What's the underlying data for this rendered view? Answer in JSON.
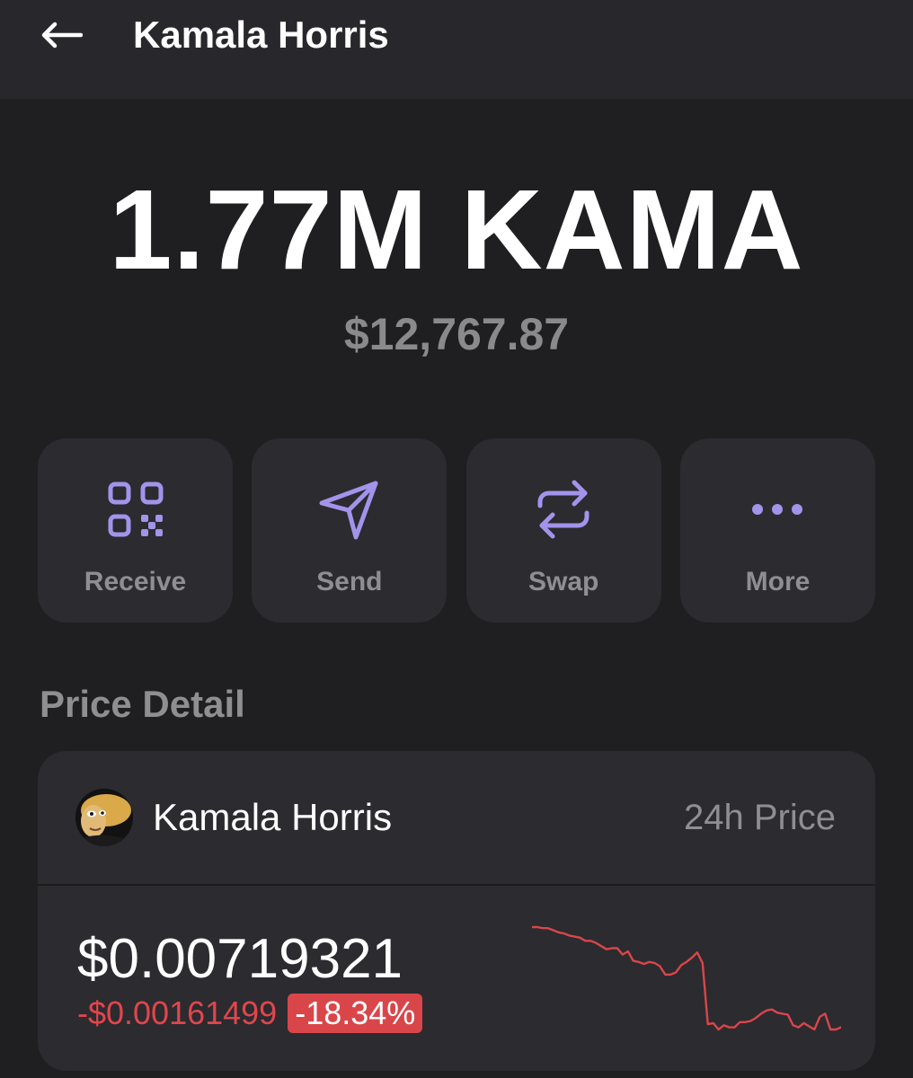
{
  "header": {
    "title": "Kamala Horris"
  },
  "balance": {
    "amount": "1.77M KAMA",
    "fiat_value": "$12,767.87"
  },
  "actions": [
    {
      "label": "Receive",
      "icon": "qr-code-icon"
    },
    {
      "label": "Send",
      "icon": "paper-plane-icon"
    },
    {
      "label": "Swap",
      "icon": "swap-arrows-icon"
    },
    {
      "label": "More",
      "icon": "more-dots-icon"
    }
  ],
  "price_detail": {
    "section_title": "Price Detail",
    "token_name": "Kamala Horris",
    "period_label": "24h Price",
    "price": "$0.00719321",
    "change_abs": "-$0.00161499",
    "change_pct": "-18.34%"
  },
  "colors": {
    "background": "#1f1f21",
    "card": "#2b2b30",
    "accent": "#a393eb",
    "negative": "#d9464a",
    "muted_text": "#8e8e93"
  },
  "sparkline_values": [
    1.0,
    1.0,
    0.99,
    0.99,
    0.97,
    0.95,
    0.94,
    0.92,
    0.91,
    0.9,
    0.87,
    0.87,
    0.85,
    0.82,
    0.79,
    0.8,
    0.8,
    0.74,
    0.77,
    0.68,
    0.67,
    0.65,
    0.67,
    0.66,
    0.63,
    0.55,
    0.55,
    0.57,
    0.64,
    0.67,
    0.71,
    0.76,
    0.66,
    0.08,
    0.09,
    0.03,
    0.07,
    0.05,
    0.05,
    0.1,
    0.1,
    0.11,
    0.14,
    0.18,
    0.21,
    0.22,
    0.19,
    0.18,
    0.17,
    0.07,
    0.05,
    0.09,
    0.06,
    0.03,
    0.15,
    0.18,
    0.03,
    0.03,
    0.05
  ]
}
